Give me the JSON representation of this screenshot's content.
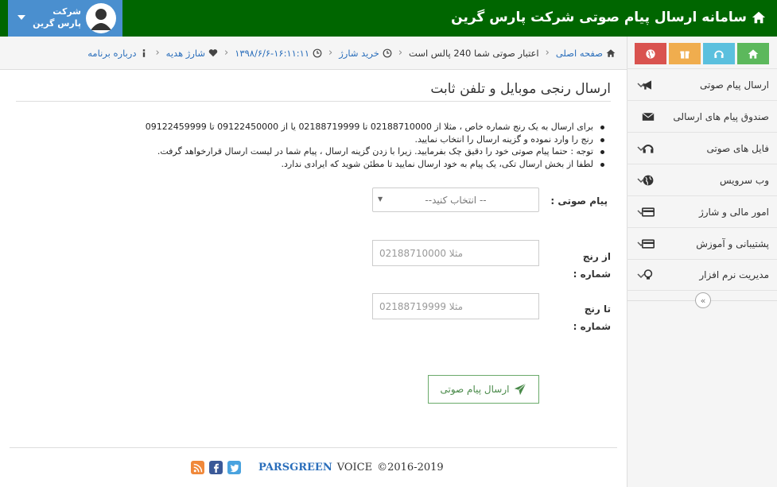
{
  "header": {
    "title": "سامانه ارسال پیام صوتی شرکت پارس گرین",
    "user_line1": "شرکت",
    "user_line2": "پارس گرین"
  },
  "quick_buttons": [
    {
      "icon": "home-icon",
      "color": "#5cb85c"
    },
    {
      "icon": "headphones-icon",
      "color": "#5bc0de"
    },
    {
      "icon": "gift-icon",
      "color": "#f0ad4e"
    },
    {
      "icon": "globe-icon",
      "color": "#d9534f"
    }
  ],
  "sidebar": {
    "items": [
      {
        "label": "ارسال پیام صوتی",
        "icon": "megaphone-icon",
        "has_chevron": true
      },
      {
        "label": "صندوق پیام های ارسالی",
        "icon": "envelope-icon",
        "has_chevron": false
      },
      {
        "label": "فایل های صوتی",
        "icon": "headphones-icon",
        "has_chevron": true
      },
      {
        "label": "وب سرویس",
        "icon": "globe-icon",
        "has_chevron": true
      },
      {
        "label": "امور مالی و شارژ",
        "icon": "credit-card-icon",
        "has_chevron": true
      },
      {
        "label": "پشتیبانی و آموزش",
        "icon": "credit-card-icon",
        "has_chevron": true
      },
      {
        "label": "مدیریت نرم افزار",
        "icon": "lightbulb-icon",
        "has_chevron": true
      }
    ],
    "collapse_label": "«"
  },
  "breadcrumb": {
    "home": "صفحه اصلی",
    "credit": "اعتبار صوتی شما 240 پالس است",
    "buy": "خرید شارژ",
    "datetime": "۱۳۹۸/۶/۶-۱۶:۱۱:۱۱",
    "gift": "شارژ هدیه",
    "about": "درباره برنامه",
    "separator": "‹"
  },
  "page": {
    "title": "ارسال رنجی موبایل و تلفن ثابت",
    "notes": [
      "برای ارسال به یک رنج شماره خاص ، مثلا از 02188710000 تا 02188719999 یا از 09122450000 تا 09122459999",
      "رنج را وارد نموده و گزینه ارسال را انتخاب نمایید.",
      "توجه : حتما پیام صوتی خود را دقیق چک بفرمایید. زیرا با زدن گزینه ارسال ، پیام شما در لیست ارسال قرارخواهد گرفت.",
      "لطفا از بخش ارسال تکی، یک پیام به خود ارسال نمایید تا مطئن شوید که ایرادی ندارد."
    ],
    "voice_label": "پیام صوتی :",
    "voice_select": "--انتخاب کنید --",
    "from_label": "از رنج شماره :",
    "from_placeholder": "مثلا 02188710000",
    "to_label": "تا رنج شماره :",
    "to_placeholder": "مثلا 02188719999",
    "submit": "ارسال پیام صوتی"
  },
  "footer": {
    "brand": "PARSGREEN",
    "voice": "VOICE",
    "copyright": "©2016-2019"
  },
  "colors": {
    "header_bg": "#006600",
    "user_bg": "#4a8fcf",
    "link": "#2a6ebb"
  }
}
